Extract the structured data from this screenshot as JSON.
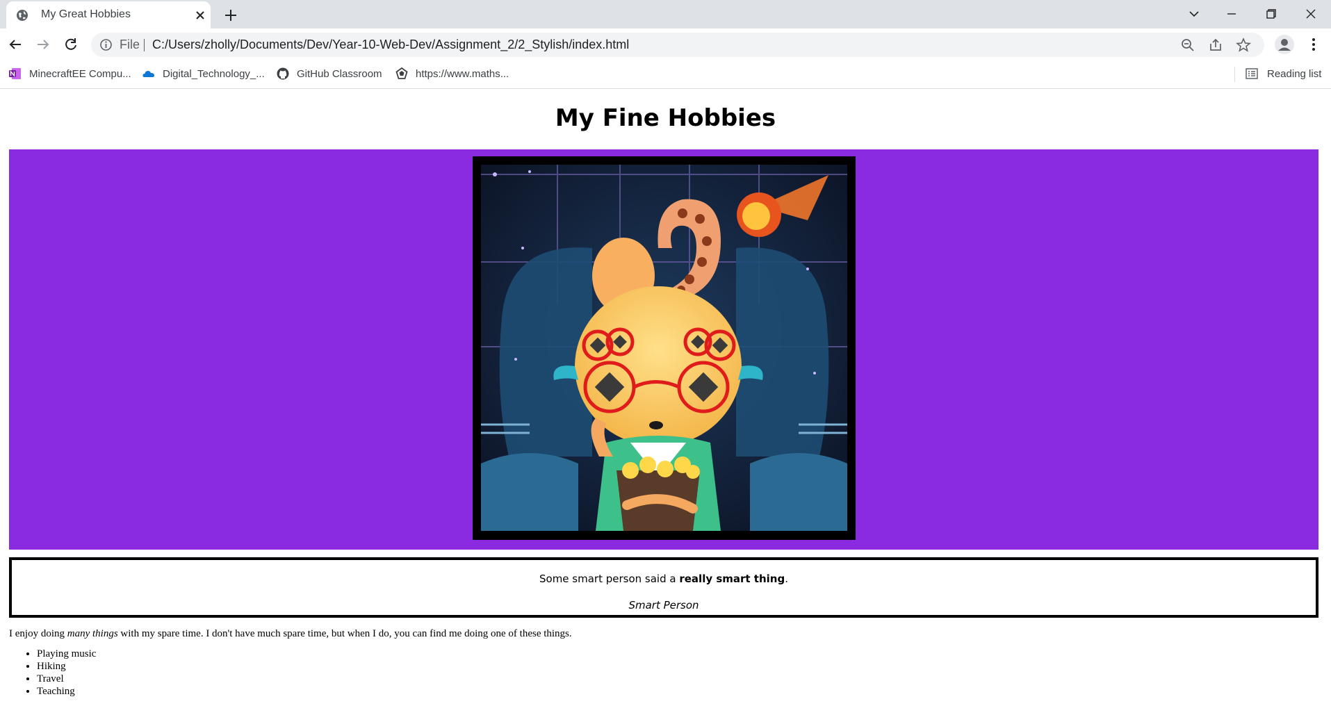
{
  "browser": {
    "tab": {
      "title": "My Great Hobbies",
      "favicon": "globe-icon"
    },
    "address": {
      "scheme_label": "File",
      "url": "C:/Users/zholly/Documents/Dev/Year-10-Web-Dev/Assignment_2/2_Stylish/index.html"
    },
    "bookmarks": [
      {
        "label": "MinecraftEE Compu...",
        "icon": "onenote-icon"
      },
      {
        "label": "Digital_Technology_...",
        "icon": "onedrive-icon"
      },
      {
        "label": "GitHub Classroom",
        "icon": "github-icon"
      },
      {
        "label": "https://www.maths...",
        "icon": "site-icon"
      }
    ],
    "reading_list": "Reading list"
  },
  "page": {
    "heading": "My Fine Hobbies",
    "banner_color": "#8a2be2",
    "quote": {
      "before": "Some smart person said a ",
      "bold": "really smart thing",
      "after": ".",
      "cite": "Smart Person"
    },
    "intro": {
      "before": "I enjoy doing ",
      "emphasis": "many things",
      "after": " with my spare time. I don't have much spare time, but when I do, you can find me doing one of these things."
    },
    "hobbies": [
      "Playing music",
      "Hiking",
      "Travel",
      "Teaching"
    ]
  }
}
